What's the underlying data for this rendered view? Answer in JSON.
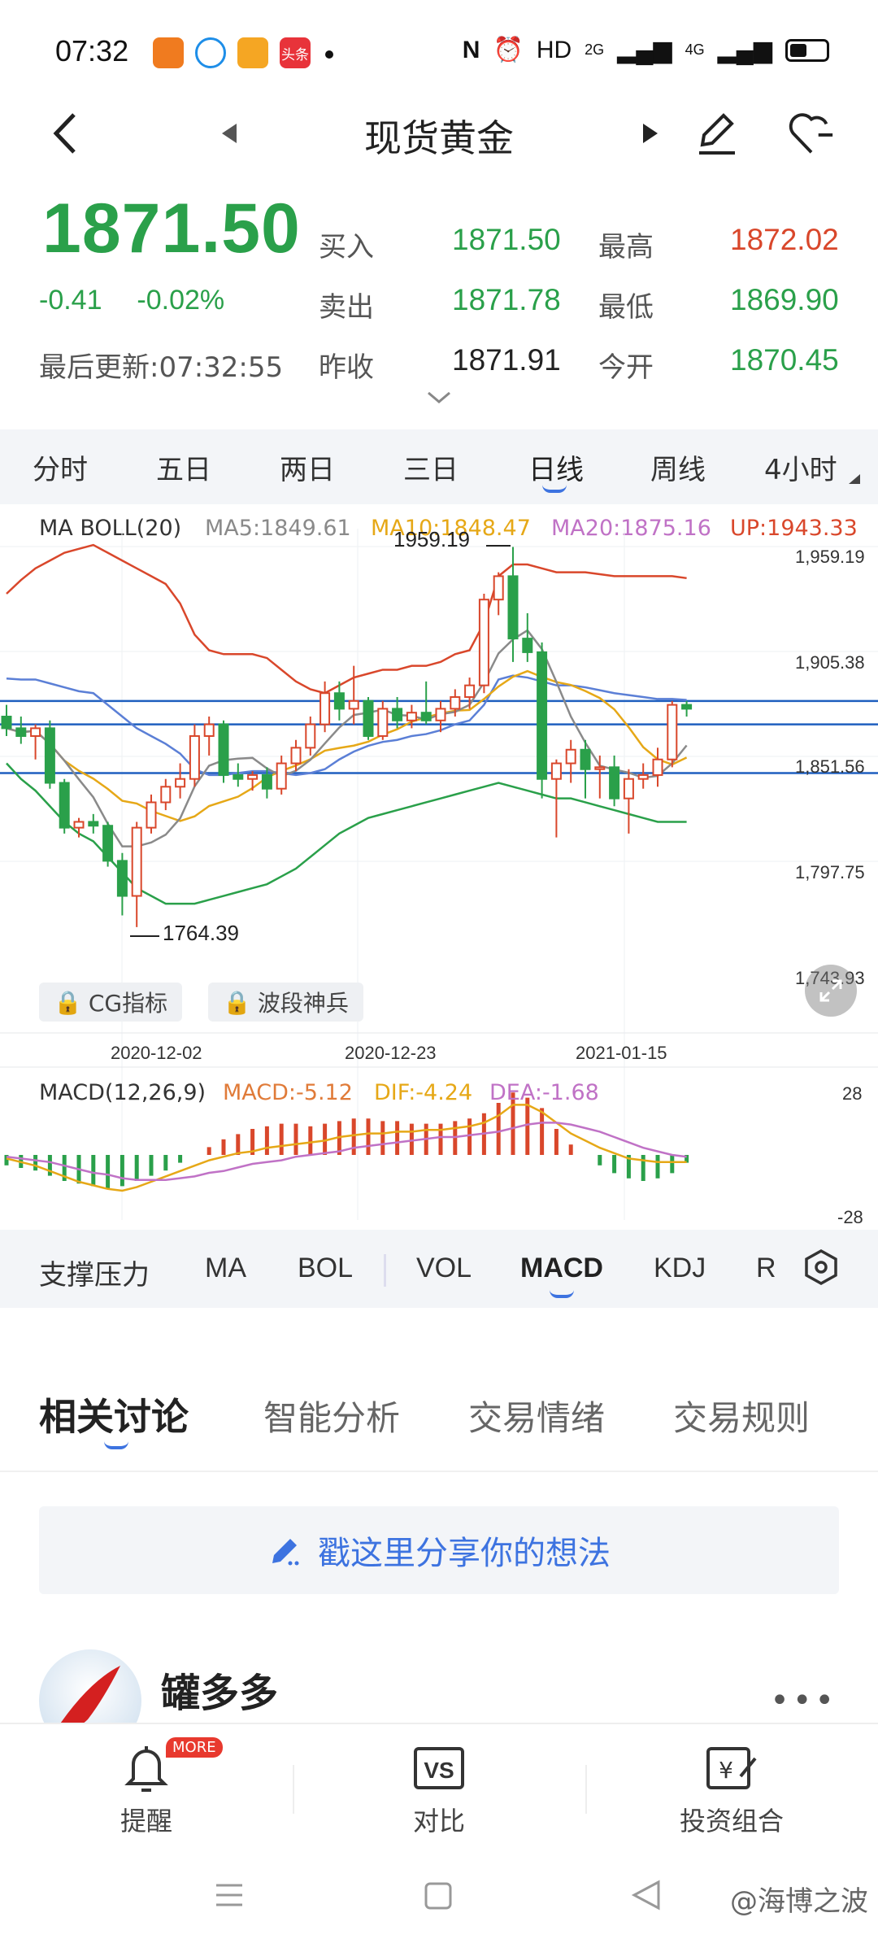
{
  "status_bar": {
    "time": "07:32",
    "apps": [
      "uc-browser-icon",
      "app-icon",
      "weibo-icon",
      "toutiao-icon"
    ],
    "toutiao_label": "头条",
    "right_text": "HD",
    "signal_2g": "2G",
    "signal_4g": "4G"
  },
  "top_nav": {
    "title": "现货黄金"
  },
  "quote": {
    "price": "1871.50",
    "change": "-0.41",
    "change_pct": "-0.02%",
    "last_update": "最后更新:07:32:55",
    "buy_label": "买入",
    "buy_value": "1871.50",
    "sell_label": "卖出",
    "sell_value": "1871.78",
    "prev_close_label": "昨收",
    "prev_close_value": "1871.91",
    "high_label": "最高",
    "high_value": "1872.02",
    "low_label": "最低",
    "low_value": "1869.90",
    "open_label": "今开",
    "open_value": "1870.45",
    "colors": {
      "up": "#d9472b",
      "down": "#2aa04a",
      "neutral": "#222222"
    }
  },
  "period_tabs": {
    "items": [
      "分时",
      "五日",
      "两日",
      "三日",
      "日线",
      "周线",
      "4小时"
    ],
    "active": "日线"
  },
  "kline_legend": {
    "boll": "MA BOLL(20)",
    "ma5": "MA5:1849.61",
    "ma10": "MA10:1848.47",
    "ma20": "MA20:1875.16",
    "up": "UP:1943.33"
  },
  "kline": {
    "max_label": "1959.19",
    "min_label": "1764.39",
    "y_ticks": [
      "1,959.19",
      "1,905.38",
      "1,851.56",
      "1,797.75",
      "1,743.93"
    ],
    "x_dates": [
      "2020-12-02",
      "2020-12-23",
      "2021-01-15"
    ],
    "locked_1": "CG指标",
    "locked_2": "波段神兵",
    "colors": {
      "up": "#d9472b",
      "down": "#2aa04a",
      "ma5": "#8a8a8a",
      "ma10": "#e6a817",
      "ma20": "#5b7fd6",
      "boll_up": "#d9472b",
      "boll_low": "#2aa04a",
      "hline": "#1f5fbf"
    }
  },
  "macd_legend": {
    "title": "MACD(12,26,9)",
    "macd": "MACD:-5.12",
    "dif": "DIF:-4.24",
    "dea": "DEA:-1.68",
    "top": "28",
    "bottom": "-28"
  },
  "indicator_tabs": {
    "items": [
      "支撑压力",
      "MA",
      "BOL",
      "VOL",
      "MACD",
      "KDJ",
      "R"
    ],
    "active": "MACD"
  },
  "discussion_tabs": {
    "items": [
      "相关讨论",
      "智能分析",
      "交易情绪",
      "交易规则"
    ],
    "active": "相关讨论"
  },
  "share_prompt": "戳这里分享你的想法",
  "post": {
    "username": "罐多多",
    "more": "•••"
  },
  "bottom_bar": {
    "items": [
      {
        "label": "提醒",
        "badge": "MORE",
        "icon": "bell-icon"
      },
      {
        "label": "对比",
        "icon": "vs-icon"
      },
      {
        "label": "投资组合",
        "icon": "portfolio-icon"
      }
    ]
  },
  "watermark": "@海博之波"
}
